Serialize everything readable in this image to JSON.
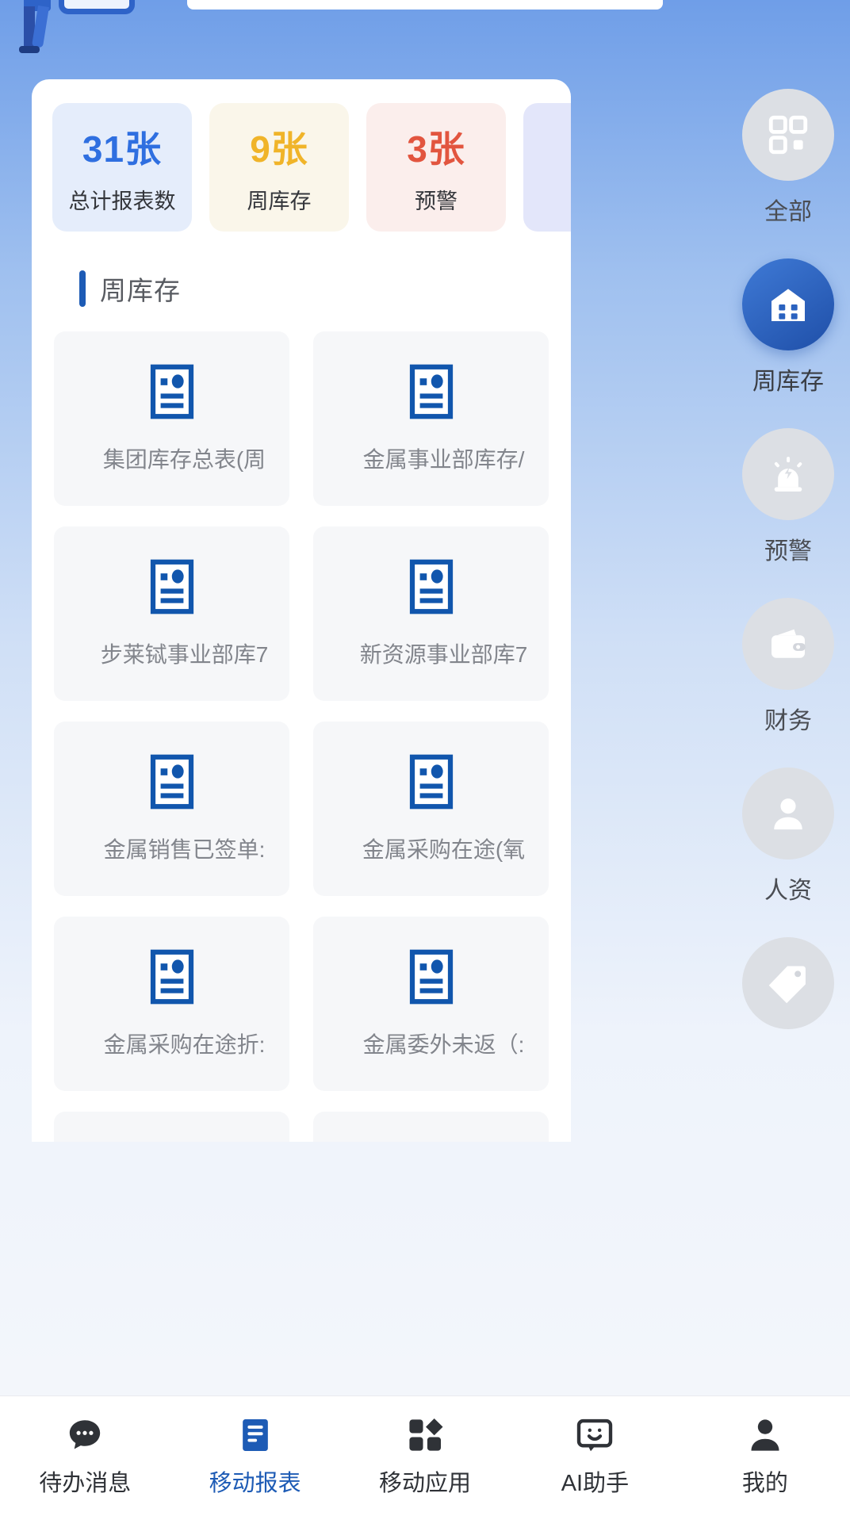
{
  "theme": {
    "accent": "#1d5bb5",
    "header_gradient_top": "#6f9ee8",
    "card_bg": "#ffffff",
    "tile_bg": "#f6f7f9",
    "blue": "#2f6fe0",
    "yellow": "#f0b429",
    "red": "#e2553f",
    "lavender": "#5b62d8",
    "muted_text": "#82858c"
  },
  "hero": {
    "illustration": "person-with-mobile-report-illustration",
    "search_placeholder": ""
  },
  "stats": [
    {
      "value": "31张",
      "label": "总计报表数",
      "tone": "blue"
    },
    {
      "value": "9张",
      "label": "周库存",
      "tone": "yellow"
    },
    {
      "value": "3张",
      "label": "预警",
      "tone": "red"
    },
    {
      "value": "",
      "label": "",
      "tone": "lav"
    }
  ],
  "section": {
    "title": "周库存"
  },
  "reports": [
    {
      "name": "集团库存总表(周",
      "icon": "report-doc-icon"
    },
    {
      "name": "金属事业部库存/",
      "icon": "report-doc-icon"
    },
    {
      "name": "步莱铽事业部库7",
      "icon": "report-doc-icon"
    },
    {
      "name": "新资源事业部库7",
      "icon": "report-doc-icon"
    },
    {
      "name": "金属销售已签单:",
      "icon": "report-doc-icon"
    },
    {
      "name": "金属采购在途(氧",
      "icon": "report-doc-icon"
    },
    {
      "name": "金属采购在途折:",
      "icon": "report-doc-icon"
    },
    {
      "name": "金属委外未返（:",
      "icon": "report-doc-icon"
    },
    {
      "name": "",
      "icon": "report-doc-icon"
    },
    {
      "name": "",
      "icon": "report-doc-icon"
    }
  ],
  "rail": [
    {
      "label": "全部",
      "icon": "grid-squares-icon",
      "active": false
    },
    {
      "label": "周库存",
      "icon": "warehouse-icon",
      "active": true
    },
    {
      "label": "预警",
      "icon": "alarm-light-icon",
      "active": false
    },
    {
      "label": "财务",
      "icon": "wallet-icon",
      "active": false
    },
    {
      "label": "人资",
      "icon": "person-icon",
      "active": false
    },
    {
      "label": "",
      "icon": "tag-icon",
      "active": false
    }
  ],
  "tabs": [
    {
      "label": "待办消息",
      "icon": "chat-dots-icon",
      "active": false
    },
    {
      "label": "移动报表",
      "icon": "report-book-icon",
      "active": true
    },
    {
      "label": "移动应用",
      "icon": "apps-grid-icon",
      "active": false
    },
    {
      "label": "AI助手",
      "icon": "ai-smiley-icon",
      "active": false
    },
    {
      "label": "我的",
      "icon": "user-solid-icon",
      "active": false
    }
  ]
}
